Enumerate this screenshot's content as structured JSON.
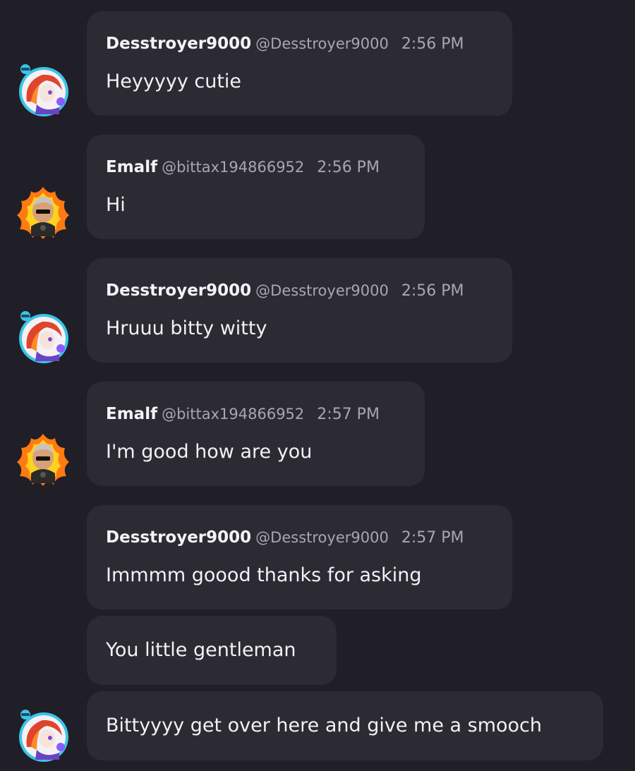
{
  "messages": [
    {
      "author": "Desstroyer9000",
      "handle": "@Desstroyer9000",
      "time": "2:56 PM",
      "text": "Heyyyyy cutie"
    },
    {
      "author": "Emalf",
      "handle": "@bittax194866952",
      "time": "2:56 PM",
      "text": "Hi"
    },
    {
      "author": "Desstroyer9000",
      "handle": "@Desstroyer9000",
      "time": "2:56 PM",
      "text": "Hruuu bitty witty"
    },
    {
      "author": "Emalf",
      "handle": "@bittax194866952",
      "time": "2:57 PM",
      "text": "I'm good how are you"
    },
    {
      "author": "Desstroyer9000",
      "handle": "@Desstroyer9000",
      "time": "2:57 PM",
      "text": "Immmm goood thanks for asking"
    },
    {
      "text": "You little gentleman"
    },
    {
      "text": "Bittyyyy get over here and give me a smooch"
    }
  ],
  "avatars": {
    "desstroyer": {
      "icon": "anime-avatar-icon",
      "ring_color": "#39c5e8"
    },
    "emalf": {
      "icon": "flame-avatar-icon",
      "flame_color": "#ff7a12"
    }
  },
  "colors": {
    "background": "#201e26",
    "bubble": "#2c2a33",
    "text": "#f2f1f5",
    "muted": "#a8a6b0"
  }
}
